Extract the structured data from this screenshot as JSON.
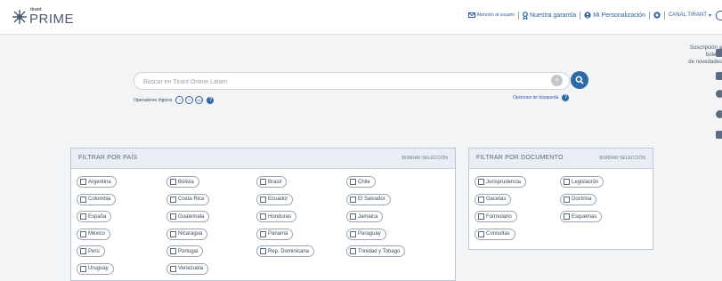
{
  "brand": {
    "small": "tirant",
    "big": "PRIME"
  },
  "topnav": {
    "atencion": "Atención al usuario",
    "garantia": "Nuestra garantía",
    "personalizacion": "Mi Personalización",
    "canal": "CANAL TIRANT",
    "canal_arrow": "▾"
  },
  "search": {
    "placeholder": "Buscar en Tirant Online Latam",
    "clear": "×"
  },
  "operators": {
    "label": "Operadores lógicos",
    "buttons": [
      "Y",
      "O",
      "NO"
    ],
    "help": "?"
  },
  "options": {
    "label": "Opciones de búsqueda",
    "help": "?"
  },
  "sidebar": {
    "line1": "Suscripción a boletín",
    "line2": "de novedades"
  },
  "country_filter": {
    "title": "FILTRAR POR PAÍS",
    "clear": "BORRAR SELECCIÓN",
    "items": [
      "Argentina",
      "Bolivia",
      "Brasil",
      "Chile",
      "Colombia",
      "Costa Rica",
      "Ecuador",
      "El Salvador",
      "España",
      "Guatemala",
      "Honduras",
      "Jamaica",
      "México",
      "Nicaragua",
      "Panamá",
      "Paraguay",
      "Perú",
      "Portugal",
      "Rep. Dominicana",
      "Trinidad y Tobago",
      "Uruguay",
      "Venezuela"
    ]
  },
  "doc_filter": {
    "title": "FILTRAR POR DOCUMENTO",
    "clear": "BORRAR SELECCIÓN",
    "items": [
      "Jurisprudencia",
      "Legislación",
      "Gacetas",
      "Doctrina",
      "Formulario",
      "Esquemas",
      "Consultas"
    ]
  },
  "colors": {
    "accent": "#2e68a6",
    "panel_border": "#b9c7d6",
    "panel_header": "#e9eef4"
  },
  "icons": {
    "mail": "mail-icon",
    "guarantee": "ribbon-icon",
    "user": "user-icon",
    "settings": "gear-icon",
    "search": "search-icon"
  }
}
